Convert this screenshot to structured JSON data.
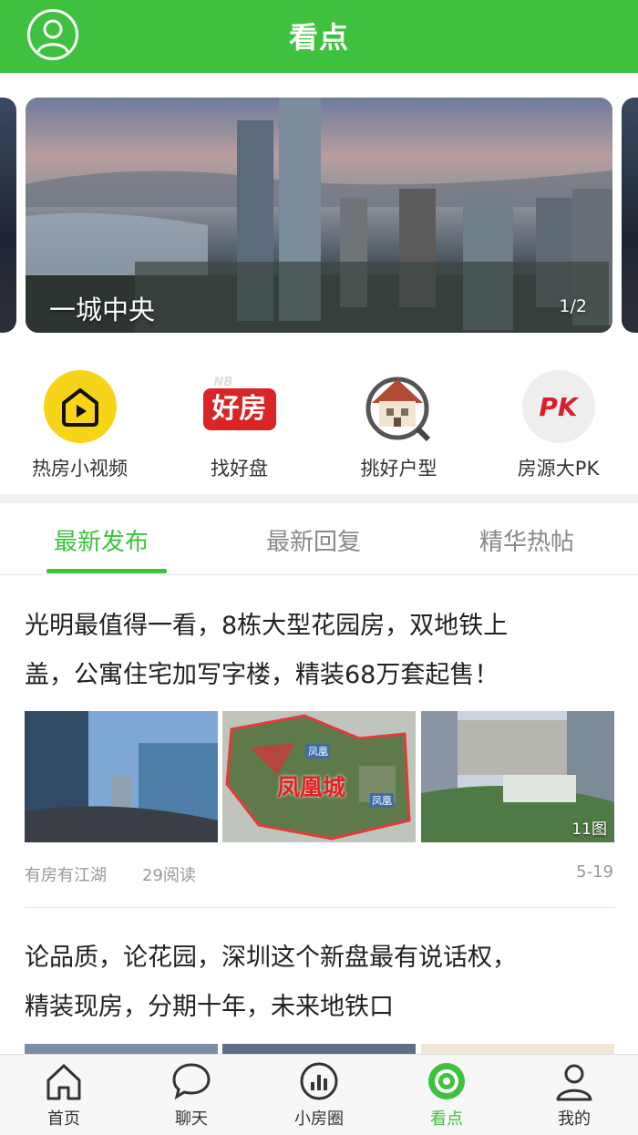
{
  "header": {
    "title": "看点",
    "profile_icon": "user-circle-icon"
  },
  "banner": {
    "caption": "一城中央",
    "pager": "1/2"
  },
  "quick_menu": [
    {
      "label": "热房小视频",
      "icon": "video-play-icon"
    },
    {
      "label": "找好盘",
      "icon": "good-house-icon",
      "badge": "好房",
      "badge_small": "NB"
    },
    {
      "label": "挑好户型",
      "icon": "house-magnifier-icon"
    },
    {
      "label": "房源大PK",
      "icon": "pk-icon",
      "badge": "PK"
    }
  ],
  "tabs": [
    {
      "label": "最新发布",
      "active": true
    },
    {
      "label": "最新回复",
      "active": false
    },
    {
      "label": "精华热帖",
      "active": false
    }
  ],
  "posts": [
    {
      "title_line1": "光明最值得一看，8栋大型花园房，双地铁上",
      "title_line2": "盖，公寓住宅加写字楼，精装68万套起售！",
      "image_count": "11图",
      "map_label": "凤凰城",
      "map_tag_1": "凤凰",
      "map_tag_2": "凤凰",
      "author": "有房有江湖",
      "reads": "29阅读",
      "date": "5-19"
    },
    {
      "title_line1": "论品质，论花园，深圳这个新盘最有说话权，",
      "title_line2": "精装现房，分期十年，未来地铁口"
    }
  ],
  "bottom_nav": [
    {
      "label": "首页",
      "icon": "home-icon",
      "active": false
    },
    {
      "label": "聊天",
      "icon": "chat-bubble-icon",
      "active": false
    },
    {
      "label": "小房圈",
      "icon": "bar-chart-circle-icon",
      "active": false
    },
    {
      "label": "看点",
      "icon": "eye-target-icon",
      "active": true
    },
    {
      "label": "我的",
      "icon": "user-icon",
      "active": false
    }
  ],
  "colors": {
    "accent": "#3fc13f",
    "text": "#222222",
    "muted": "#999999"
  }
}
